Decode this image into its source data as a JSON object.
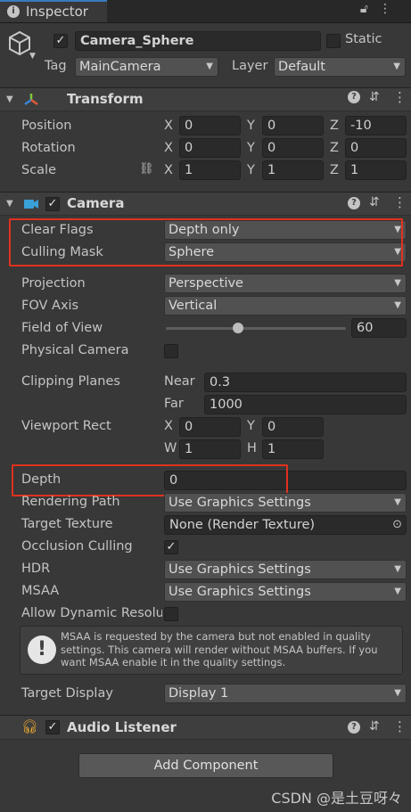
{
  "tab": {
    "label": "Inspector",
    "info_icon": "info-icon",
    "lock_icon": "lock-icon",
    "menu_icon": "kebab-menu-icon"
  },
  "header": {
    "name": "Camera_Sphere",
    "static_label": "Static",
    "tag_label": "Tag",
    "tag_value": "MainCamera",
    "layer_label": "Layer",
    "layer_value": "Default",
    "object_icon": "cube-icon"
  },
  "transform": {
    "title": "Transform",
    "rows": [
      {
        "label": "Position",
        "x": "0",
        "y": "0",
        "z": "-10"
      },
      {
        "label": "Rotation",
        "x": "0",
        "y": "0",
        "z": "0"
      },
      {
        "label": "Scale",
        "x": "1",
        "y": "1",
        "z": "1"
      }
    ],
    "axis_x": "X",
    "axis_y": "Y",
    "axis_z": "Z"
  },
  "camera": {
    "title": "Camera",
    "clear_flags_label": "Clear Flags",
    "clear_flags_value": "Depth only",
    "culling_mask_label": "Culling Mask",
    "culling_mask_value": "Sphere",
    "projection_label": "Projection",
    "projection_value": "Perspective",
    "fov_axis_label": "FOV Axis",
    "fov_axis_value": "Vertical",
    "fov_label": "Field of View",
    "fov_value": "60",
    "fov_slider_fraction": 0.403,
    "physical_label": "Physical Camera",
    "clipping_label": "Clipping Planes",
    "near_label": "Near",
    "near_value": "0.3",
    "far_label": "Far",
    "far_value": "1000",
    "viewport_label": "Viewport Rect",
    "vp_x_label": "X",
    "vp_x": "0",
    "vp_y_label": "Y",
    "vp_y": "0",
    "vp_w_label": "W",
    "vp_w": "1",
    "vp_h_label": "H",
    "vp_h": "1",
    "depth_label": "Depth",
    "depth_value": "0",
    "rendering_path_label": "Rendering Path",
    "rendering_path_value": "Use Graphics Settings",
    "target_texture_label": "Target Texture",
    "target_texture_value": "None (Render Texture)",
    "occlusion_label": "Occlusion Culling",
    "hdr_label": "HDR",
    "hdr_value": "Use Graphics Settings",
    "msaa_label": "MSAA",
    "msaa_value": "Use Graphics Settings",
    "dynamic_res_label": "Allow Dynamic Resolu",
    "help_text": "MSAA is requested by the camera but not enabled in quality settings. This camera will render without MSAA buffers. If you want MSAA enable it in the quality settings.",
    "target_display_label": "Target Display",
    "target_display_value": "Display 1"
  },
  "audio_listener": {
    "title": "Audio Listener"
  },
  "add_component_label": "Add Component",
  "watermark": "CSDN @是土豆呀々",
  "colors": {
    "highlight": "#e0321e",
    "accent": "#3a79bb",
    "background": "#383838"
  }
}
